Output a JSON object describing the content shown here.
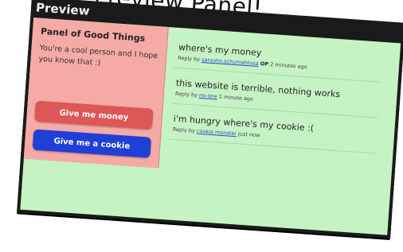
{
  "caption": "Preview Panel!",
  "window": {
    "title": "Preview"
  },
  "panel": {
    "title": "Panel of Good Things",
    "text": "You're a cool person and I hope you know that :)",
    "buttons": {
      "money": "Give me money",
      "cookie": "Give me a cookie"
    }
  },
  "comments": [
    {
      "text": "where's my money",
      "reply_prefix": "Reply by",
      "author": "sarvohn.schumahtosa",
      "badge": "OP",
      "time": "2 minutes ago"
    },
    {
      "text": "this website is terrible, nothing works",
      "reply_prefix": "Reply by",
      "author": "no-one",
      "badge": "",
      "time": "1 minute ago"
    },
    {
      "text": "i'm hungry where's my cookie :(",
      "reply_prefix": "Reply by",
      "author": "cookie monster",
      "badge": "",
      "time": "just now"
    }
  ],
  "colors": {
    "content_bg": "#c6f3c3",
    "panel_bg": "#f5aaa6",
    "money_button": "#dd5757",
    "cookie_button": "#1f3fd6",
    "link": "#2a4bd0"
  }
}
